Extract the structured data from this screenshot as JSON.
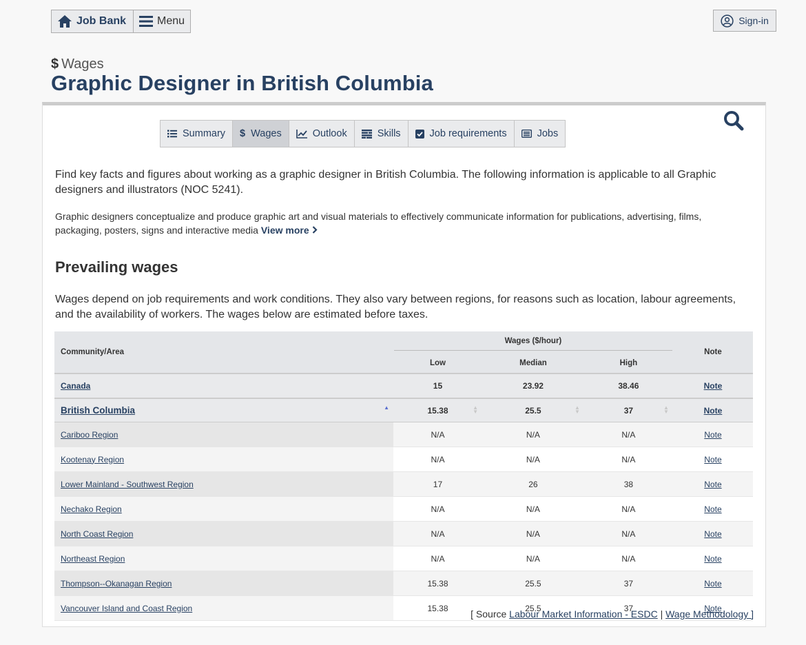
{
  "topbar": {
    "jobbank_label": "Job Bank",
    "menu_label": "Menu",
    "signin_label": "Sign-in"
  },
  "header": {
    "kicker": "Wages",
    "title": "Graphic Designer in British Columbia"
  },
  "tabs": [
    {
      "label": "Summary",
      "icon": "list-icon",
      "active": false
    },
    {
      "label": "Wages",
      "icon": "dollar-icon",
      "active": true
    },
    {
      "label": "Outlook",
      "icon": "line-chart-icon",
      "active": false
    },
    {
      "label": "Skills",
      "icon": "skills-icon",
      "active": false
    },
    {
      "label": "Job requirements",
      "icon": "checkbox-icon",
      "active": false
    },
    {
      "label": "Jobs",
      "icon": "jobs-list-icon",
      "active": false
    }
  ],
  "intro": "Find key facts and figures about working as a graphic designer in British Columbia. The following information is applicable to all Graphic designers and illustrators (NOC 5241).",
  "description": "Graphic designers conceptualize and produce graphic art and visual materials to effectively communicate information for publications, advertising, films, packaging, posters, signs and interactive media",
  "view_more": "View more",
  "section_title": "Prevailing wages",
  "wages_text": "Wages depend on job requirements and work conditions. They also vary between regions, for reasons such as location, labour agreements, and the availability of workers. The wages below are estimated before taxes.",
  "table": {
    "col_community": "Community/Area",
    "col_wages_group": "Wages ($/hour)",
    "col_note": "Note",
    "col_low": "Low",
    "col_median": "Median",
    "col_high": "High",
    "canada": {
      "name": "Canada",
      "low": "15",
      "median": "23.92",
      "high": "38.46",
      "note": "Note"
    },
    "bc": {
      "name": "British Columbia",
      "low": "15.38",
      "median": "25.5",
      "high": "37",
      "note": "Note"
    },
    "regions": [
      {
        "name": "Cariboo Region",
        "low": "N/A",
        "median": "N/A",
        "high": "N/A",
        "note": "Note"
      },
      {
        "name": "Kootenay Region",
        "low": "N/A",
        "median": "N/A",
        "high": "N/A",
        "note": "Note"
      },
      {
        "name": "Lower Mainland - Southwest Region",
        "low": "17",
        "median": "26",
        "high": "38",
        "note": "Note"
      },
      {
        "name": "Nechako Region",
        "low": "N/A",
        "median": "N/A",
        "high": "N/A",
        "note": "Note"
      },
      {
        "name": "North Coast Region",
        "low": "N/A",
        "median": "N/A",
        "high": "N/A",
        "note": "Note"
      },
      {
        "name": "Northeast Region",
        "low": "N/A",
        "median": "N/A",
        "high": "N/A",
        "note": "Note"
      },
      {
        "name": "Thompson--Okanagan Region",
        "low": "15.38",
        "median": "25.5",
        "high": "37",
        "note": "Note"
      },
      {
        "name": "Vancouver Island and Coast Region",
        "low": "15.38",
        "median": "25.5",
        "high": "37",
        "note": "Note"
      }
    ]
  },
  "source": {
    "prefix": "[ Source",
    "link1": "Labour Market Information - ESDC",
    "separator": "|",
    "link2": "Wage Methodology ]"
  },
  "colors": {
    "brand": "#284162",
    "active_tab": "#cfd1d5",
    "table_header": "#e4e6e9"
  }
}
